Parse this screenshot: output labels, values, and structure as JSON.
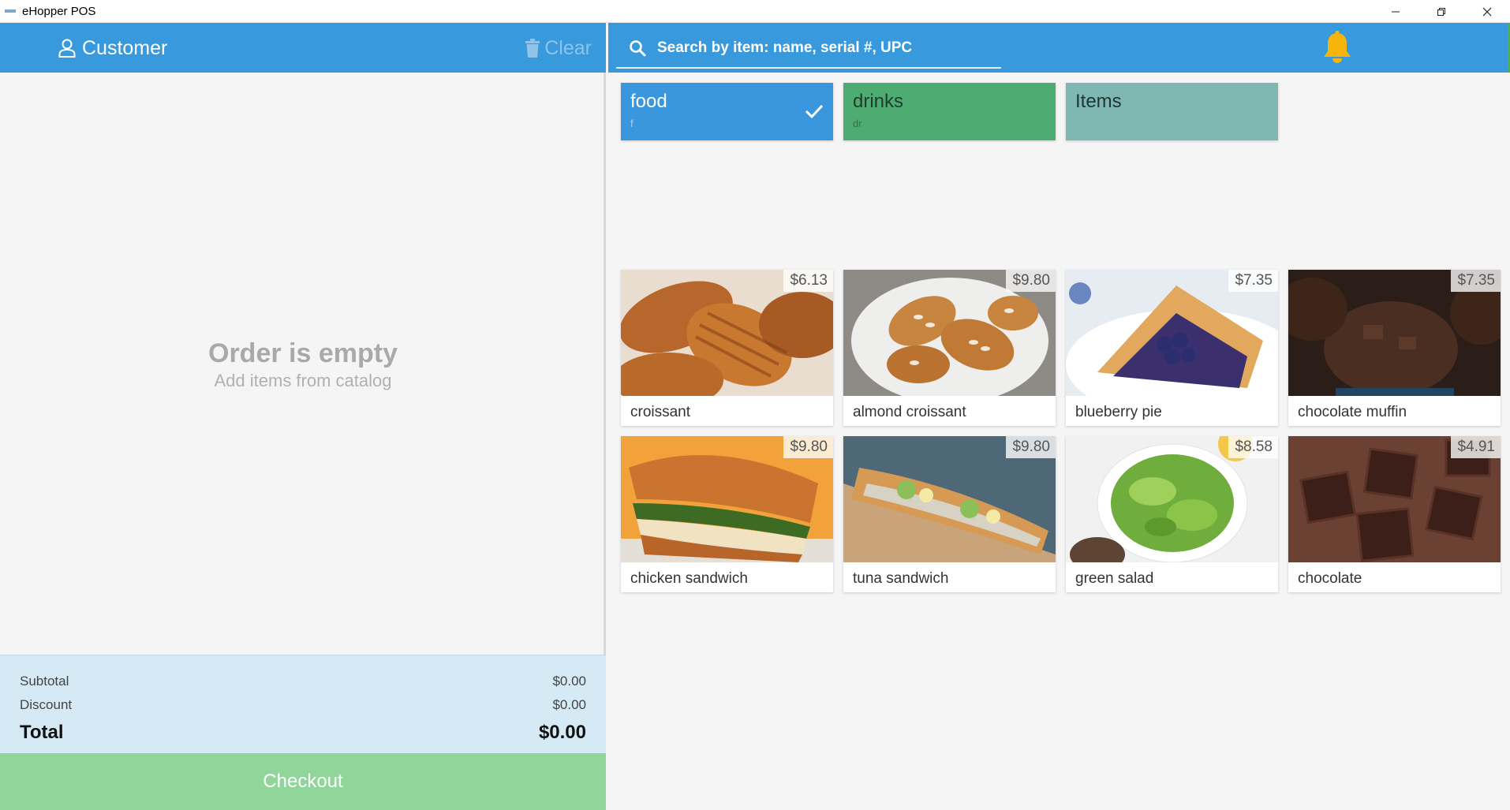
{
  "window": {
    "title": "eHopper POS"
  },
  "order": {
    "customer_label": "Customer",
    "clear_label": "Clear",
    "empty_title": "Order is empty",
    "empty_subtitle": "Add items from catalog",
    "subtotal_label": "Subtotal",
    "subtotal_value": "$0.00",
    "discount_label": "Discount",
    "discount_value": "$0.00",
    "total_label": "Total",
    "total_value": "$0.00",
    "checkout_label": "Checkout"
  },
  "search": {
    "placeholder": "Search by item: name, serial #, UPC"
  },
  "colors": {
    "header_blue": "#3899dd",
    "food_blue": "#3a96dd",
    "drinks_green": "#4dac71",
    "items_teal": "#7fb7b2",
    "checkout_green": "#90d59a",
    "totals_bg": "#d6eaf6",
    "bell_yellow": "#f5b50a"
  },
  "categories": [
    {
      "name": "food",
      "code": "f",
      "selected": true
    },
    {
      "name": "drinks",
      "code": "dr",
      "selected": false
    },
    {
      "name": "Items",
      "code": "",
      "selected": false
    }
  ],
  "products": [
    {
      "name": "croissant",
      "price": "$6.13",
      "icon": "croissant-image"
    },
    {
      "name": "almond croissant",
      "price": "$9.80",
      "icon": "almond-croissant-image"
    },
    {
      "name": "blueberry pie",
      "price": "$7.35",
      "icon": "blueberry-pie-image"
    },
    {
      "name": "chocolate muffin",
      "price": "$7.35",
      "icon": "chocolate-muffin-image"
    },
    {
      "name": "chicken sandwich",
      "price": "$9.80",
      "icon": "chicken-sandwich-image"
    },
    {
      "name": "tuna sandwich",
      "price": "$9.80",
      "icon": "tuna-sandwich-image"
    },
    {
      "name": "green salad",
      "price": "$8.58",
      "icon": "green-salad-image"
    },
    {
      "name": "chocolate",
      "price": "$4.91",
      "icon": "chocolate-image"
    }
  ]
}
